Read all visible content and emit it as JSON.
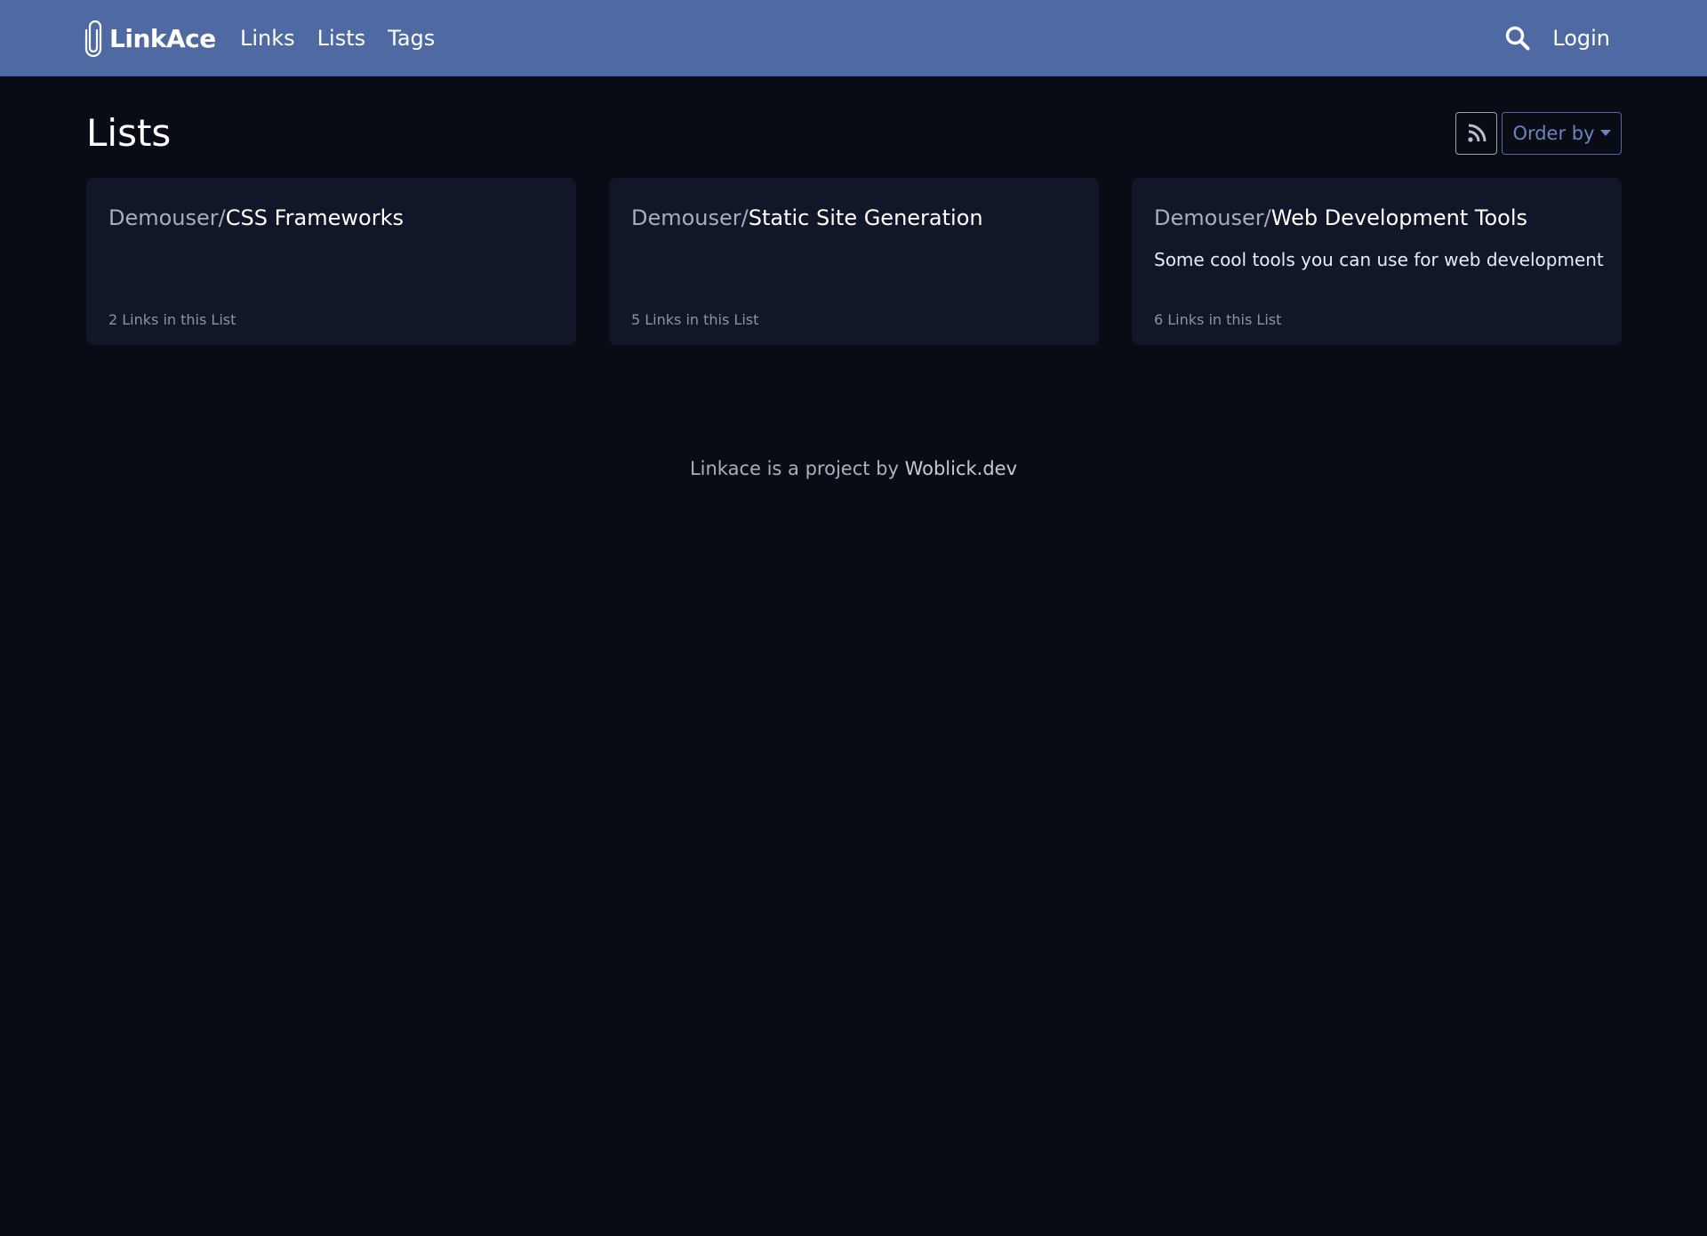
{
  "navbar": {
    "brand": "LinkAce",
    "links": [
      "Links",
      "Lists",
      "Tags"
    ],
    "login_label": "Login",
    "background_color": "#4f6aa3",
    "icons": {
      "brand": "paperclip-icon",
      "search": "search-icon"
    }
  },
  "page": {
    "title": "Lists",
    "rss_icon": "rss-icon",
    "order_label": "Order by",
    "order_icon": "caret-down-icon",
    "background_color": "#090c14"
  },
  "cards": [
    {
      "owner": "Demouser/",
      "name": "CSS Frameworks",
      "description": "",
      "count_label": "2 Links in this List"
    },
    {
      "owner": "Demouser/",
      "name": "Static Site Generation",
      "description": "",
      "count_label": "5 Links in this List"
    },
    {
      "owner": "Demouser/",
      "name": "Web Development Tools",
      "description": "Some cool tools you can use for web development",
      "count_label": "6 Links in this List"
    }
  ],
  "footer": {
    "text": "Linkace is a project by ",
    "link_label": "Woblick.dev"
  }
}
